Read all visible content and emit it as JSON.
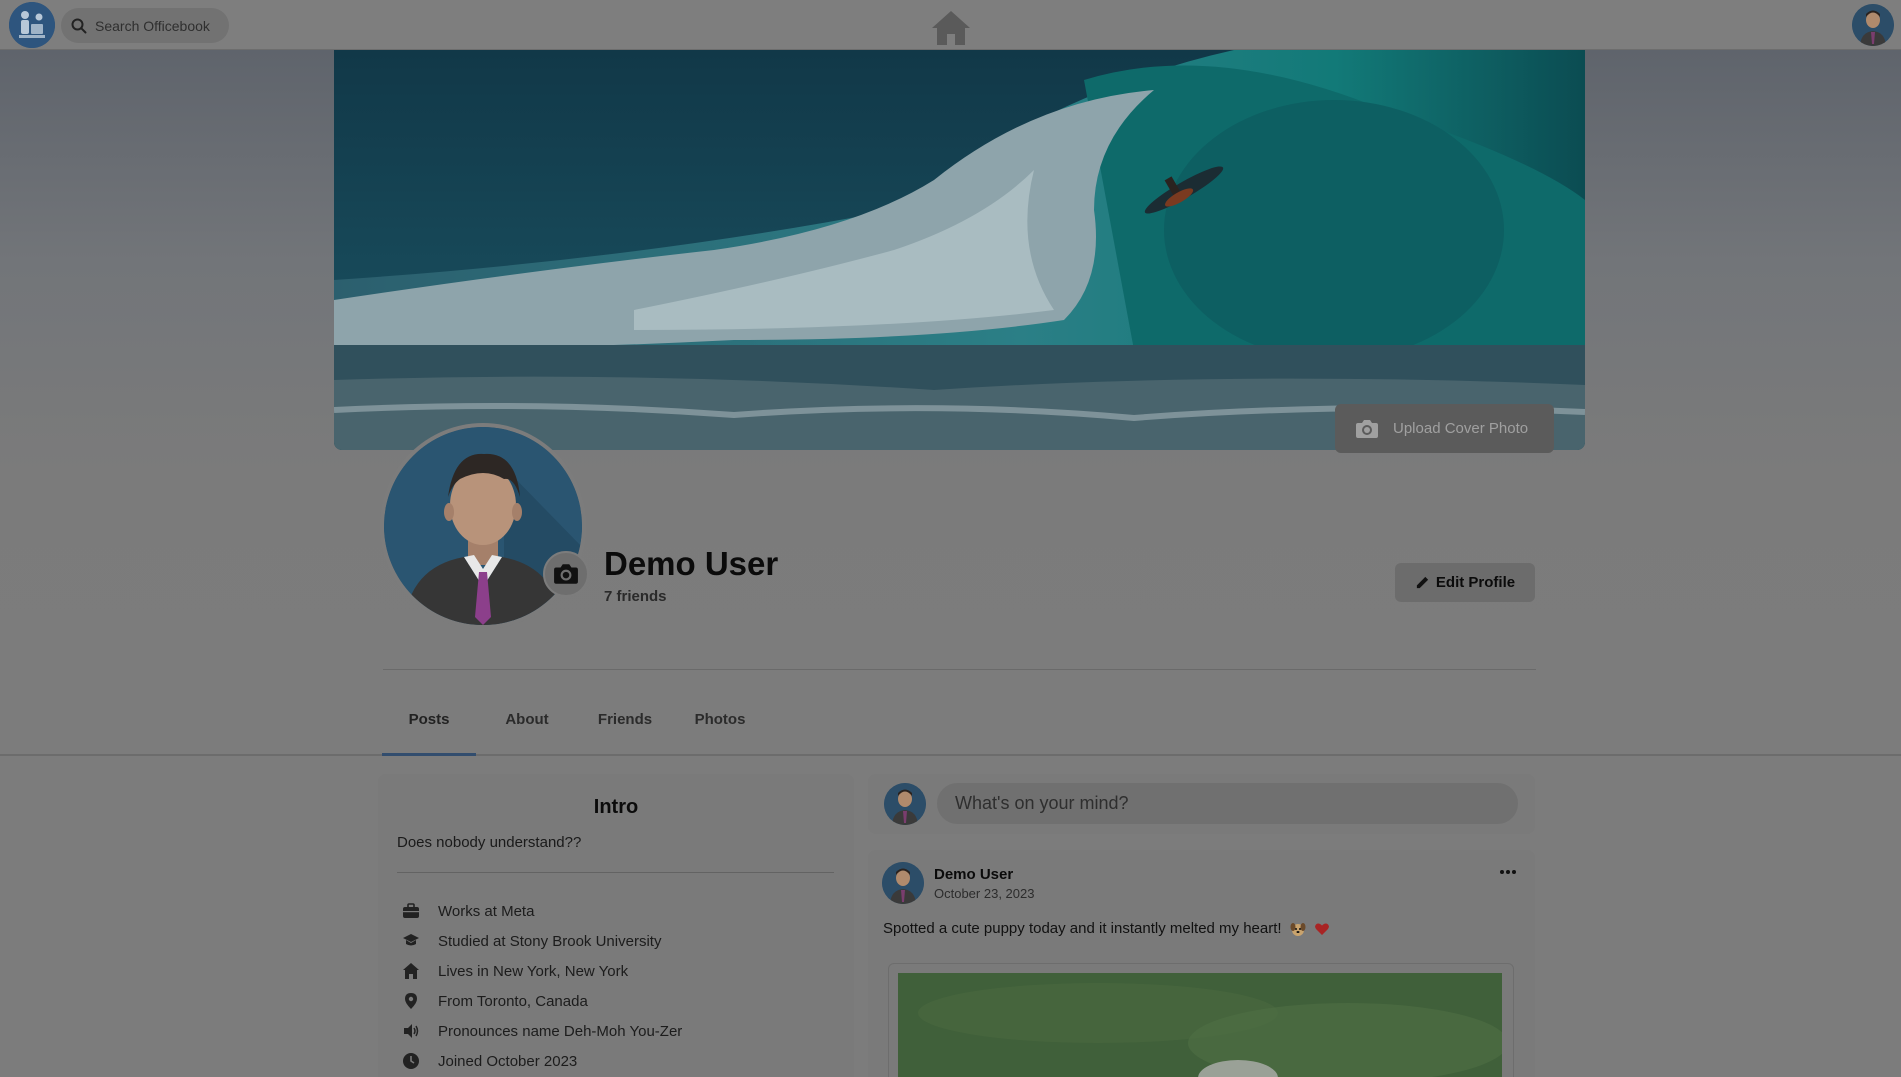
{
  "topbar": {
    "search_placeholder": "Search Officebook"
  },
  "profile": {
    "name": "Demo User",
    "friends": "7 friends",
    "upload_cover_label": "Upload Cover Photo",
    "edit_profile_label": "Edit Profile"
  },
  "tabs": [
    {
      "label": "Posts"
    },
    {
      "label": "About"
    },
    {
      "label": "Friends"
    },
    {
      "label": "Photos"
    }
  ],
  "intro": {
    "title": "Intro",
    "bio": "Does nobody understand??",
    "items": [
      {
        "icon": "briefcase-icon",
        "text": "Works at Meta"
      },
      {
        "icon": "graduation-cap-icon",
        "text": "Studied at Stony Brook University"
      },
      {
        "icon": "home-icon",
        "text": "Lives in New York, New York"
      },
      {
        "icon": "location-pin-icon",
        "text": "From Toronto, Canada"
      },
      {
        "icon": "speaker-icon",
        "text": "Pronounces name Deh-Moh You-Zer"
      },
      {
        "icon": "clock-icon",
        "text": "Joined October 2023"
      }
    ]
  },
  "composer": {
    "placeholder": "What's on your mind?"
  },
  "post": {
    "author": "Demo User",
    "date": "October 23, 2023",
    "text": "Spotted a cute puppy today and it instantly melted my heart!",
    "menu_label": "···"
  },
  "colors": {
    "tab_active_underline": "#324d6e",
    "heart": "#a82424"
  }
}
